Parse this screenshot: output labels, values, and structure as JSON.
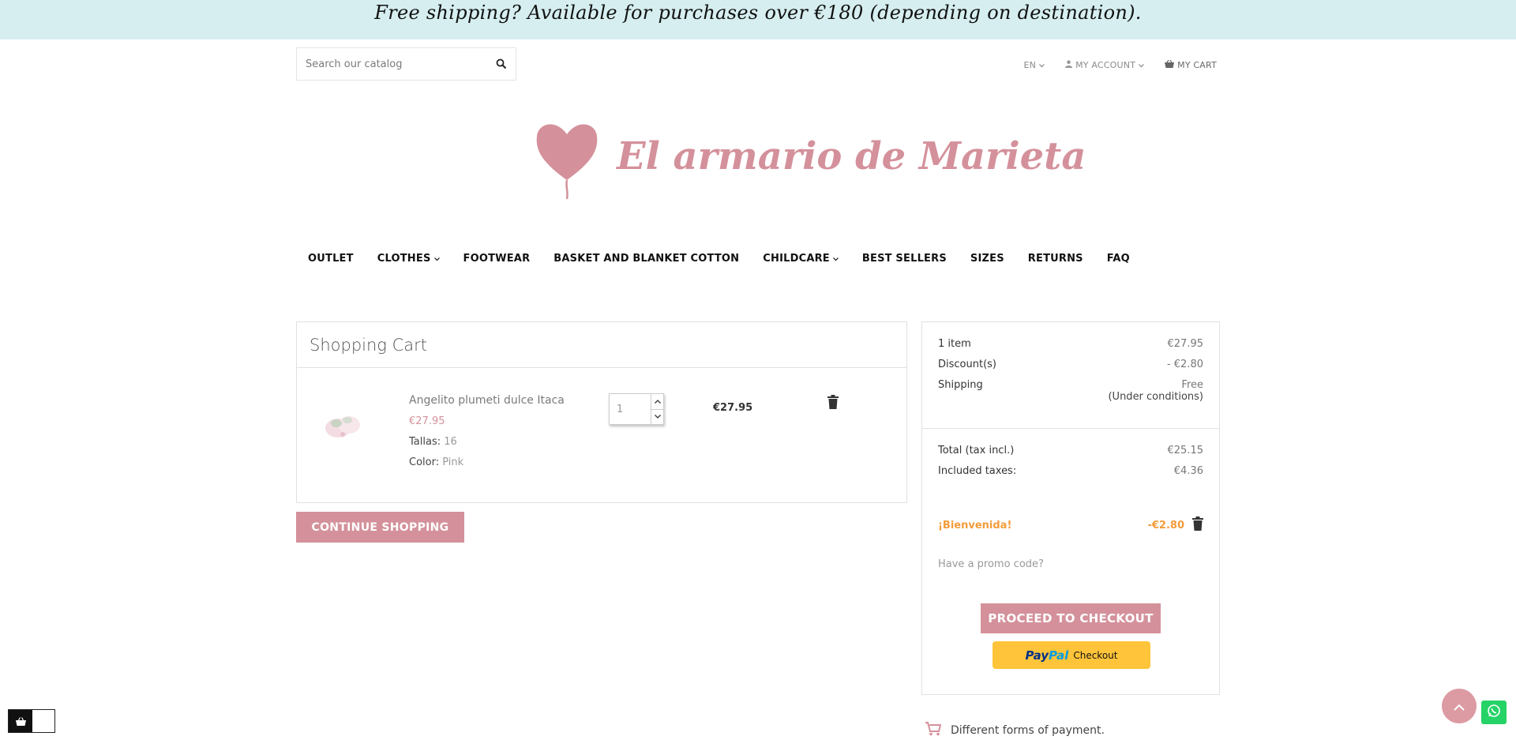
{
  "promo_banner": {
    "text": "Free shipping? Available for purchases over €180 (depending on destination)."
  },
  "search": {
    "placeholder": "Search our catalog",
    "icon": "search-icon"
  },
  "topnav": {
    "language": "EN",
    "account": "MY ACCOUNT",
    "cart": "MY CART"
  },
  "logo": {
    "text": "El armario de Marieta"
  },
  "mainnav": [
    {
      "label": "OUTLET",
      "has_dropdown": false
    },
    {
      "label": "CLOTHES",
      "has_dropdown": true
    },
    {
      "label": "FOOTWEAR",
      "has_dropdown": false
    },
    {
      "label": "BASKET AND BLANKET COTTON",
      "has_dropdown": false
    },
    {
      "label": "CHILDCARE",
      "has_dropdown": true
    },
    {
      "label": "BEST SELLERS",
      "has_dropdown": false
    },
    {
      "label": "SIZES",
      "has_dropdown": false
    },
    {
      "label": "RETURNS",
      "has_dropdown": false
    },
    {
      "label": "FAQ",
      "has_dropdown": false
    }
  ],
  "cart": {
    "title": "Shopping Cart",
    "item": {
      "name": "Angelito plumeti dulce Itaca",
      "price": "€27.95",
      "size_label": "Tallas:",
      "size_value": "16",
      "color_label": "Color:",
      "color_value": "Pink",
      "quantity": "1",
      "line_total": "€27.95"
    },
    "continue_label": "CONTINUE SHOPPING"
  },
  "summary": {
    "items_label": "1 item",
    "items_value": "€27.95",
    "discount_label": "Discount(s)",
    "discount_value": "- €2.80",
    "shipping_label": "Shipping",
    "shipping_value": "Free",
    "shipping_note": "(Under conditions)",
    "total_label": "Total (tax incl.)",
    "total_value": "€25.15",
    "taxes_label": "Included taxes:",
    "taxes_value": "€4.36",
    "voucher_name": "¡Bienvenida!",
    "voucher_value": "-€2.80",
    "promo_link": "Have a promo code?",
    "checkout_label": "PROCEED TO CHECKOUT",
    "paypal_word1": "Pay",
    "paypal_word2": "Pal",
    "paypal_checkout": "Checkout"
  },
  "payments": {
    "text": "Different forms of payment."
  },
  "colors": {
    "accent": "#d4919b",
    "banner_bg": "#d6eef0",
    "voucher": "#f39c3b",
    "paypal": "#ffc439",
    "whatsapp": "#25d366"
  }
}
